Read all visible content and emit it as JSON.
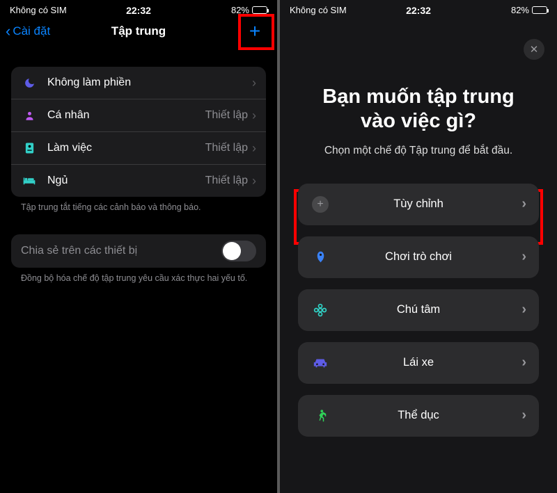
{
  "status": {
    "sim": "Không có SIM",
    "time": "22:32",
    "battery": "82%"
  },
  "screen1": {
    "back": "Cài đặt",
    "title": "Tập trung",
    "rows": [
      {
        "icon": "moon",
        "label": "Không làm phiền",
        "detail": ""
      },
      {
        "icon": "person",
        "label": "Cá nhân",
        "detail": "Thiết lập"
      },
      {
        "icon": "badge",
        "label": "Làm việc",
        "detail": "Thiết lập"
      },
      {
        "icon": "bed",
        "label": "Ngủ",
        "detail": "Thiết lập"
      }
    ],
    "section_footer": "Tập trung tắt tiếng các cảnh báo và thông báo.",
    "toggle_label": "Chia sẻ trên các thiết bị",
    "toggle_footer": "Đồng bộ hóa chế độ tập trung yêu cầu xác thực hai yếu tố."
  },
  "screen2": {
    "title": "Bạn muốn tập trung vào việc gì?",
    "subtitle": "Chọn một chế độ Tập trung để bắt đầu.",
    "options": [
      {
        "icon": "plus",
        "label": "Tùy chỉnh"
      },
      {
        "icon": "rocket",
        "label": "Chơi trò chơi"
      },
      {
        "icon": "mind",
        "label": "Chú tâm"
      },
      {
        "icon": "car",
        "label": "Lái xe"
      },
      {
        "icon": "run",
        "label": "Thể dục"
      }
    ]
  }
}
